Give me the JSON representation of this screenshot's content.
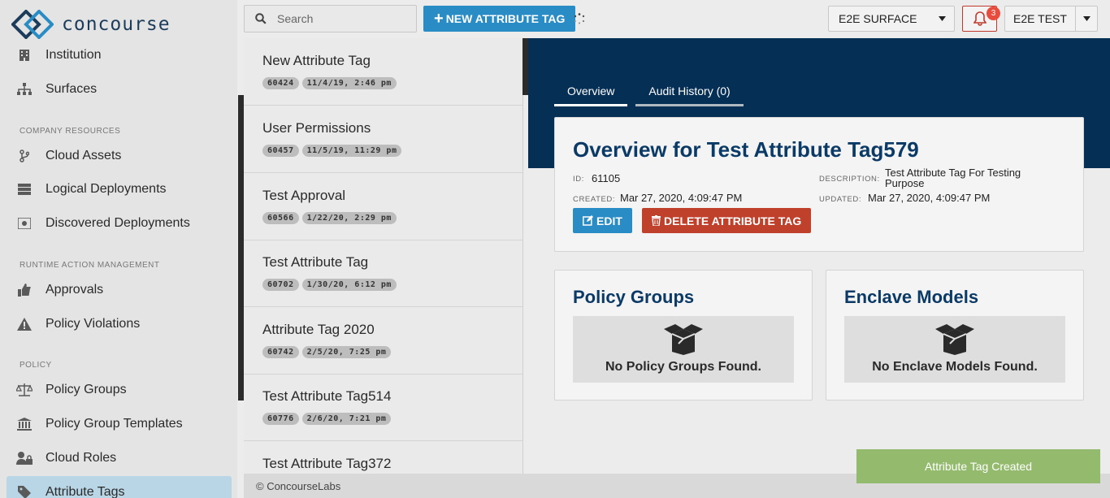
{
  "brand": {
    "name": "concourse"
  },
  "sidebar": {
    "items": [
      {
        "label": "Institution",
        "icon": "building-icon"
      },
      {
        "label": "Surfaces",
        "icon": "sitemap-icon"
      },
      {
        "label": "Cloud Assets",
        "icon": "branch-icon"
      },
      {
        "label": "Logical Deployments",
        "icon": "server-icon"
      },
      {
        "label": "Discovered Deployments",
        "icon": "scan-icon"
      },
      {
        "label": "Approvals",
        "icon": "thumbs-up-icon"
      },
      {
        "label": "Policy Violations",
        "icon": "warning-icon"
      },
      {
        "label": "Policy Groups",
        "icon": "scale-icon"
      },
      {
        "label": "Policy Group Templates",
        "icon": "bank-icon"
      },
      {
        "label": "Cloud Roles",
        "icon": "user-lock-icon"
      },
      {
        "label": "Attribute Tags",
        "icon": "tag-icon"
      }
    ],
    "sections": {
      "company_resources": "COMPANY RESOURCES",
      "runtime_action_management": "RUNTIME ACTION MANAGEMENT",
      "policy": "POLICY"
    }
  },
  "topbar": {
    "search_placeholder": "Search",
    "new_button": "NEW ATTRIBUTE TAG",
    "surface_select": "E2E SURFACE",
    "notification_count": "3",
    "user": "E2E TEST"
  },
  "list": {
    "items": [
      {
        "title": "New Attribute Tag",
        "id": "60424",
        "date": "11/4/19, 2:46 pm"
      },
      {
        "title": "User Permissions",
        "id": "60457",
        "date": "11/5/19, 11:29 pm"
      },
      {
        "title": "Test Approval",
        "id": "60566",
        "date": "1/22/20, 2:29 pm"
      },
      {
        "title": "Test Attribute Tag",
        "id": "60702",
        "date": "1/30/20, 6:12 pm"
      },
      {
        "title": "Attribute Tag 2020",
        "id": "60742",
        "date": "2/5/20, 7:25 pm"
      },
      {
        "title": "Test Attribute Tag514",
        "id": "60776",
        "date": "2/6/20, 7:21 pm"
      },
      {
        "title": "Test Attribute Tag372",
        "id": "",
        "date": ""
      }
    ]
  },
  "tabs": [
    {
      "label": "Overview"
    },
    {
      "label": "Audit History (0)"
    }
  ],
  "overview": {
    "title": "Overview for Test Attribute Tag579",
    "id_label": "ID:",
    "id": "61105",
    "created_label": "CREATED:",
    "created": "Mar 27, 2020, 4:09:47 PM",
    "description_label": "DESCRIPTION:",
    "description": "Test Attribute Tag For Testing Purpose",
    "updated_label": "UPDATED:",
    "updated": "Mar 27, 2020, 4:09:47 PM",
    "edit_button": "EDIT",
    "delete_button": "DELETE ATTRIBUTE TAG"
  },
  "policy_groups": {
    "title": "Policy Groups",
    "empty": "No Policy Groups Found."
  },
  "enclave_models": {
    "title": "Enclave Models",
    "empty": "No Enclave Models Found."
  },
  "footer": {
    "text": "© ConcourseLabs"
  },
  "toast": {
    "text": "Attribute Tag Created"
  },
  "colors": {
    "primary": "#2a8cc4",
    "danger": "#c0412b",
    "hero": "#062f55",
    "title": "#0b3a66",
    "toast": "#94bb6d"
  }
}
